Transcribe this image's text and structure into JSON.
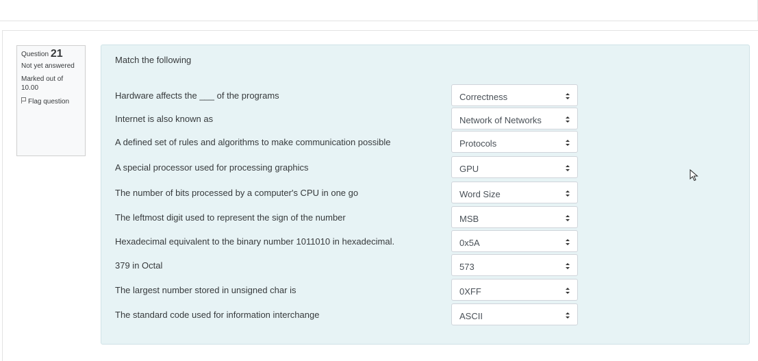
{
  "question": {
    "label": "Question",
    "number": "21",
    "status": "Not yet answered",
    "marks": "Marked out of 10.00",
    "flag_label": "Flag question"
  },
  "prompt": "Match the following",
  "rows": [
    {
      "text": "Hardware affects the ___ of the programs",
      "selected": "Correctness"
    },
    {
      "text": "Internet is also known as",
      "selected": "Network of Networks"
    },
    {
      "text": "A defined set of rules and algorithms to make communication possible",
      "selected": "Protocols"
    },
    {
      "text": "A special processor used for processing graphics",
      "selected": "GPU"
    },
    {
      "text": "The number of bits processed by a computer's CPU in one go",
      "selected": "Word Size"
    },
    {
      "text": "The leftmost digit used to represent the sign of the number",
      "selected": "MSB"
    },
    {
      "text": "Hexadecimal equivalent to the binary number 1011010 in hexadecimal.",
      "selected": "0x5A"
    },
    {
      "text": "379 in Octal",
      "selected": "573"
    },
    {
      "text": "The largest number stored in unsigned char is",
      "selected": "0XFF"
    },
    {
      "text": "The standard code used for information interchange",
      "selected": "ASCII"
    }
  ],
  "icons": {
    "flag": "flag-icon",
    "select_arrows": "updown-icon",
    "cursor": "mouse-pointer-icon"
  },
  "colors": {
    "content_background": "#e7f3f5",
    "info_background": "#f8f9fa"
  }
}
